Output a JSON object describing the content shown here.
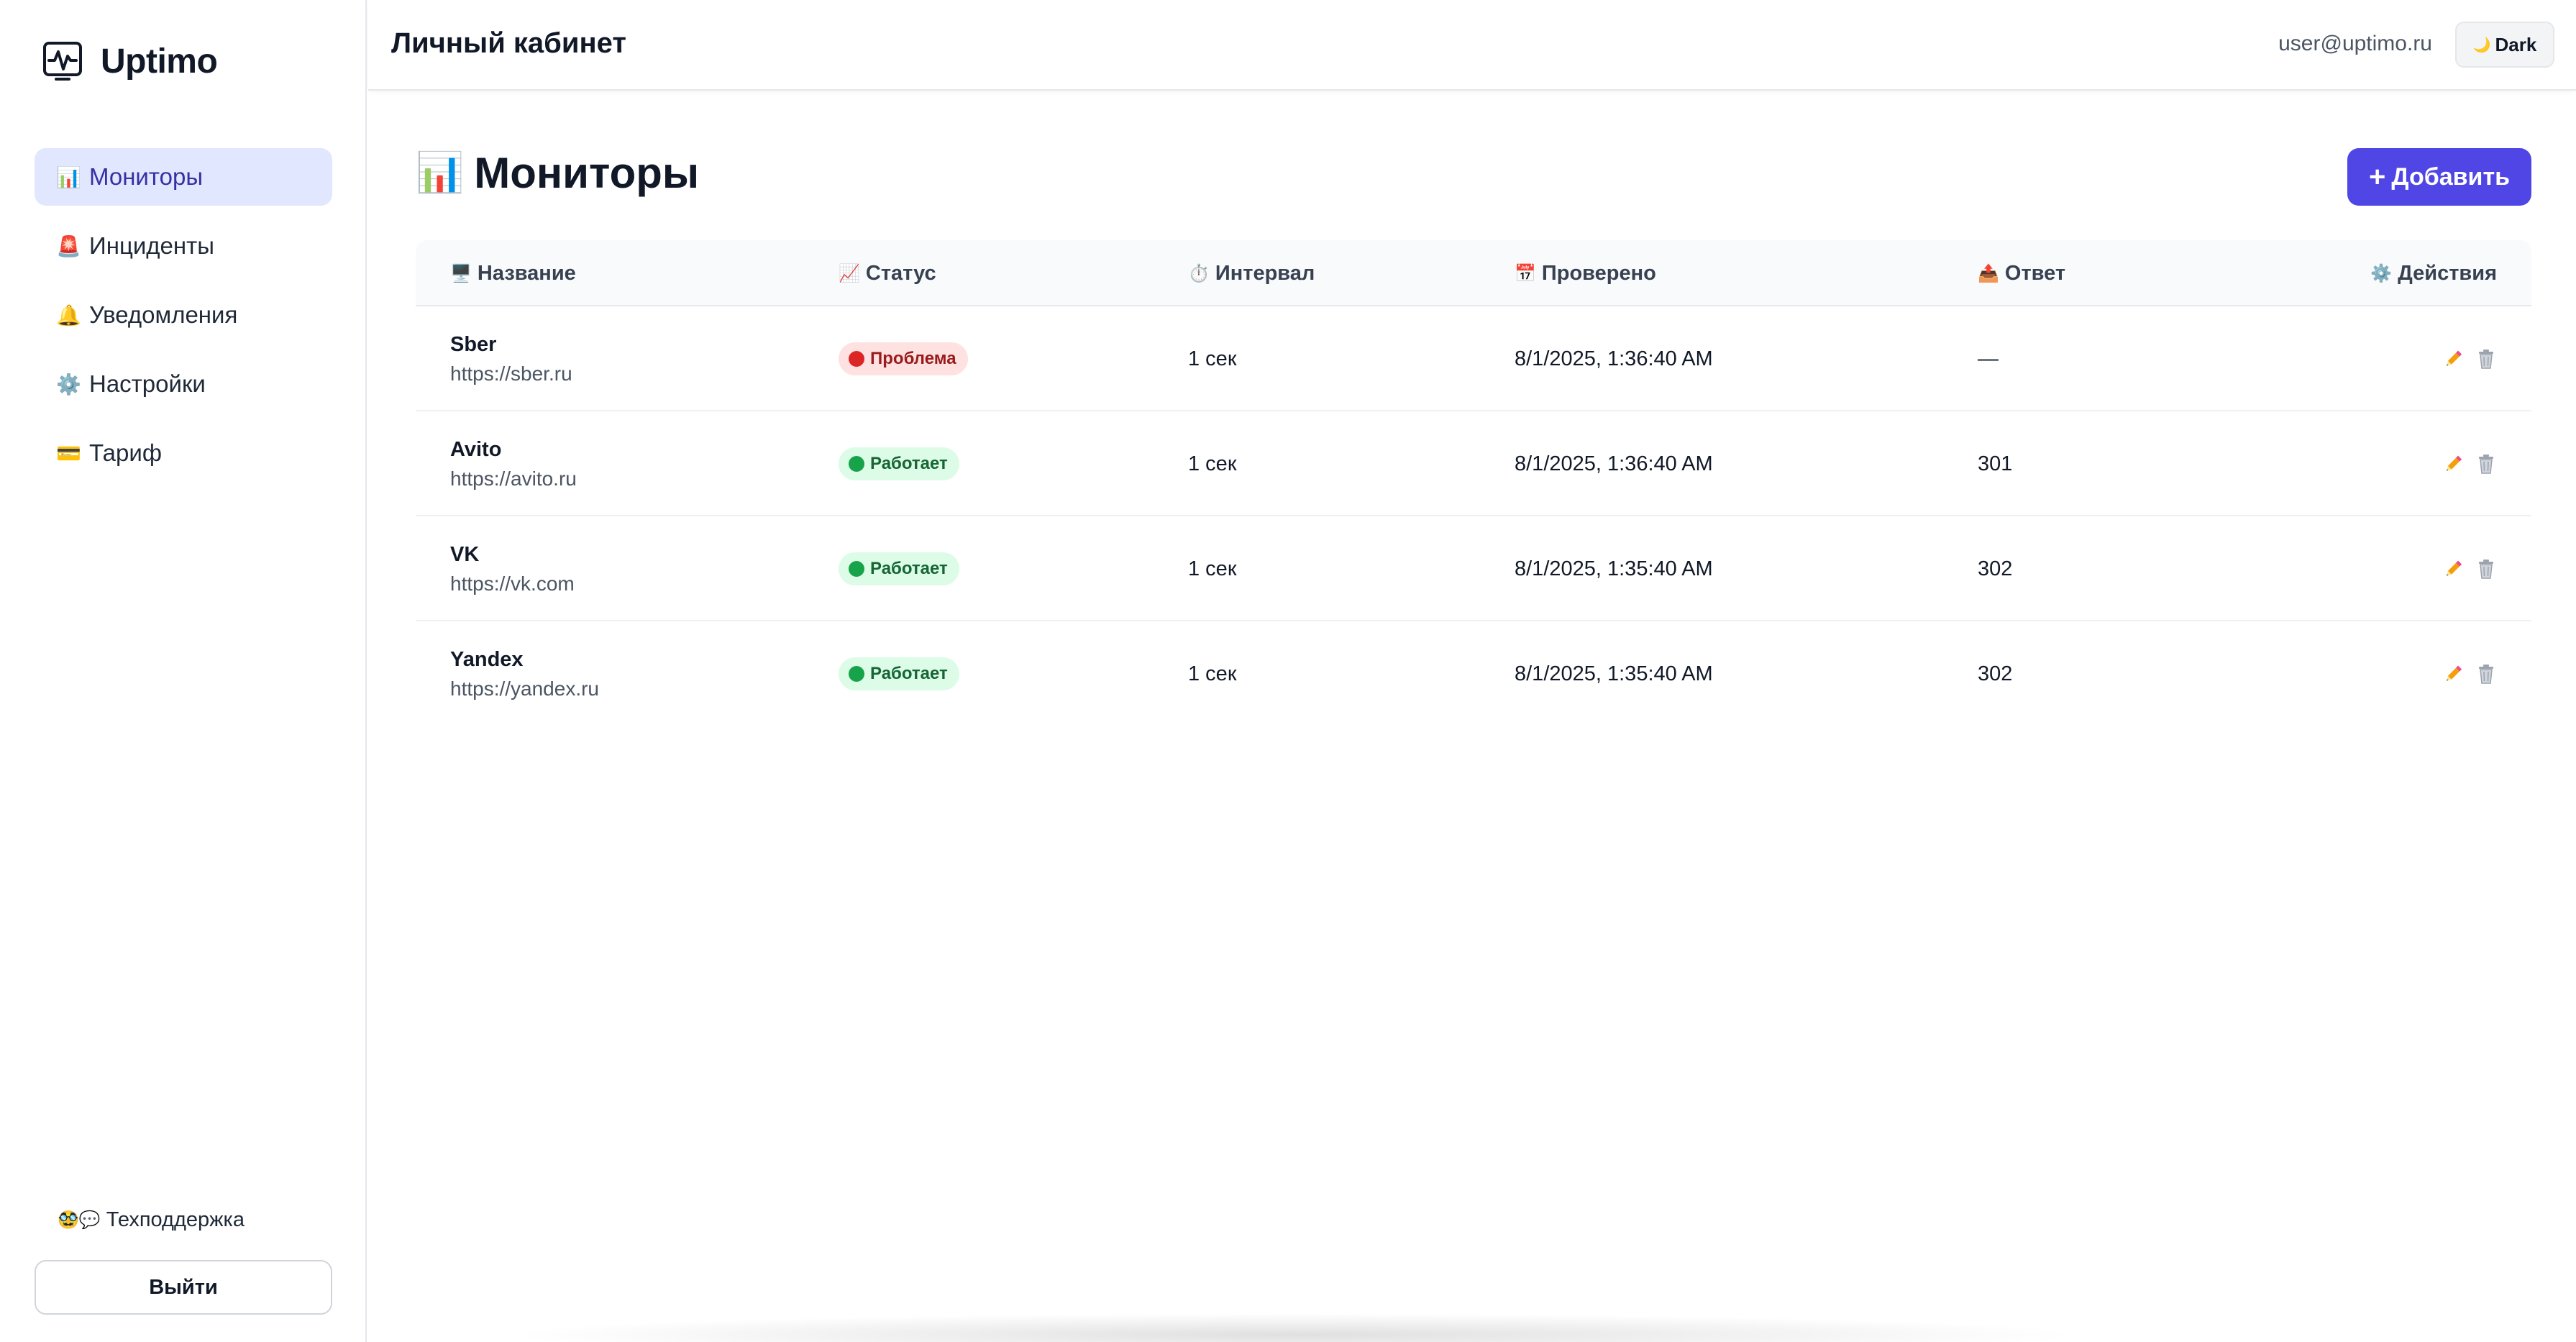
{
  "app": {
    "name": "Uptimo"
  },
  "sidebar": {
    "items": [
      {
        "emoji": "📊",
        "label": "Мониторы",
        "active": true
      },
      {
        "emoji": "🚨",
        "label": "Инциденты",
        "active": false
      },
      {
        "emoji": "🔔",
        "label": "Уведомления",
        "active": false
      },
      {
        "emoji": "⚙️",
        "label": "Настройки",
        "active": false
      },
      {
        "emoji": "💳",
        "label": "Тариф",
        "active": false
      }
    ],
    "support": {
      "emoji": "🥸💬",
      "label": "Техподдержка"
    },
    "logout_label": "Выйти"
  },
  "header": {
    "title": "Личный кабинет",
    "user_email": "user@uptimo.ru",
    "theme_emoji": "🌙",
    "theme_label": "Dark"
  },
  "main": {
    "title_emoji": "📊",
    "title": "Мониторы",
    "add_label": "Добавить",
    "columns": [
      {
        "emoji": "🖥️",
        "label": "Название"
      },
      {
        "emoji": "📈",
        "label": "Статус"
      },
      {
        "emoji": "⏱️",
        "label": "Интервал"
      },
      {
        "emoji": "📅",
        "label": "Проверено"
      },
      {
        "emoji": "📤",
        "label": "Ответ"
      },
      {
        "emoji": "⚙️",
        "label": "Действия"
      }
    ],
    "rows": [
      {
        "name": "Sber",
        "url": "https://sber.ru",
        "status": "Проблема",
        "status_kind": "down",
        "interval": "1 сек",
        "checked": "8/1/2025, 1:36:40 AM",
        "response": "—"
      },
      {
        "name": "Avito",
        "url": "https://avito.ru",
        "status": "Работает",
        "status_kind": "up",
        "interval": "1 сек",
        "checked": "8/1/2025, 1:36:40 AM",
        "response": "301"
      },
      {
        "name": "VK",
        "url": "https://vk.com",
        "status": "Работает",
        "status_kind": "up",
        "interval": "1 сек",
        "checked": "8/1/2025, 1:35:40 AM",
        "response": "302"
      },
      {
        "name": "Yandex",
        "url": "https://yandex.ru",
        "status": "Работает",
        "status_kind": "up",
        "interval": "1 сек",
        "checked": "8/1/2025, 1:35:40 AM",
        "response": "302"
      }
    ]
  },
  "colors": {
    "accent": "#4f46e5",
    "active_nav_bg": "#e0e7ff",
    "status_down_dot": "#dc2626",
    "status_up_dot": "#16a34a"
  }
}
